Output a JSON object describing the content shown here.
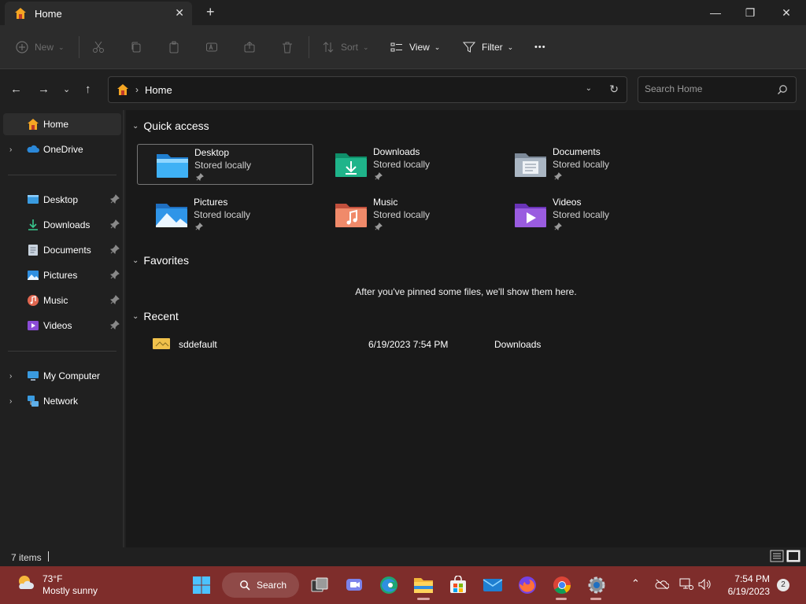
{
  "window": {
    "tab_title": "Home",
    "tab_close": "✕",
    "new_tab": "+",
    "minimize": "—",
    "maximize": "❐",
    "close": "✕"
  },
  "toolbar": {
    "new_label": "New",
    "sort_label": "Sort",
    "view_label": "View",
    "filter_label": "Filter",
    "more_label": "•••"
  },
  "address": {
    "crumb": "Home",
    "separator": "›",
    "search_placeholder": "Search Home"
  },
  "sidebar": {
    "home": "Home",
    "onedrive": "OneDrive",
    "pinned": [
      {
        "label": "Desktop",
        "icon": "desktop-icon"
      },
      {
        "label": "Downloads",
        "icon": "downloads-icon"
      },
      {
        "label": "Documents",
        "icon": "documents-icon"
      },
      {
        "label": "Pictures",
        "icon": "pictures-icon"
      },
      {
        "label": "Music",
        "icon": "music-icon"
      },
      {
        "label": "Videos",
        "icon": "videos-icon"
      }
    ],
    "my_computer": "My Computer",
    "network": "Network"
  },
  "main": {
    "quick_access_title": "Quick access",
    "quick_access": [
      {
        "name": "Desktop",
        "sub": "Stored locally"
      },
      {
        "name": "Downloads",
        "sub": "Stored locally"
      },
      {
        "name": "Documents",
        "sub": "Stored locally"
      },
      {
        "name": "Pictures",
        "sub": "Stored locally"
      },
      {
        "name": "Music",
        "sub": "Stored locally"
      },
      {
        "name": "Videos",
        "sub": "Stored locally"
      }
    ],
    "favorites_title": "Favorites",
    "favorites_empty": "After you've pinned some files, we'll show them here.",
    "recent_title": "Recent",
    "recent": [
      {
        "name": "sddefault",
        "date": "6/19/2023 7:54 PM",
        "location": "Downloads"
      }
    ]
  },
  "status": {
    "item_count": "7 items"
  },
  "taskbar": {
    "temperature": "73°F",
    "condition": "Mostly sunny",
    "search_label": "Search",
    "time": "7:54 PM",
    "date": "6/19/2023",
    "notification_count": "2"
  },
  "colors": {
    "accent": "#4cc2ff",
    "taskbar": "#7e2d2b",
    "folder_yellow": "#f0c14b"
  }
}
